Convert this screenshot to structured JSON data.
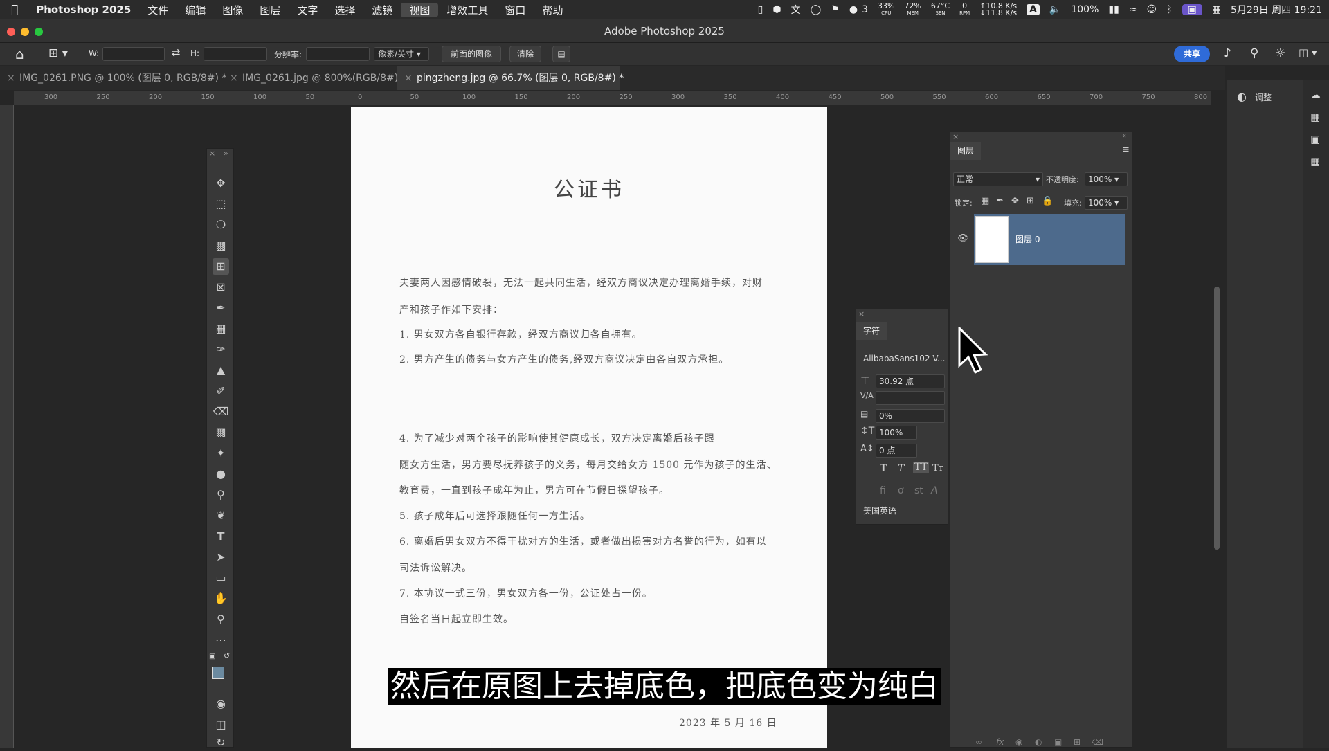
{
  "menubar": {
    "app_name": "Photoshop 2025",
    "items": [
      "文件",
      "编辑",
      "图像",
      "图层",
      "文字",
      "选择",
      "滤镜",
      "视图",
      "增效工具",
      "窗口",
      "帮助"
    ],
    "active_item": "视图",
    "wechat_count": "3",
    "cpu": "33%",
    "cpu_label": "CPU",
    "mem": "72%",
    "mem_label": "MEM",
    "temp": "67°C",
    "temp_label": "SEN",
    "rpm": "0",
    "rpm_label": "RPM",
    "net_up": "↑10.8 K/s",
    "net_down": "↓11.8 K/s",
    "input_method": "A",
    "battery": "100%",
    "datetime": "5月29日 周四  19:21"
  },
  "window": {
    "title": "Adobe Photoshop 2025"
  },
  "options": {
    "w_label": "W:",
    "h_label": "H:",
    "resolution_label": "分辨率:",
    "unit_select": "像素/英寸",
    "front_image_button": "前面的图像",
    "clear_button": "清除",
    "share_button": "共享"
  },
  "tabs": [
    {
      "label": "IMG_0261.PNG @ 100% (图层 0, RGB/8#) *"
    },
    {
      "label": "IMG_0261.jpg @ 800%(RGB/8#)"
    },
    {
      "label": "pingzheng.jpg @ 66.7% (图层 0, RGB/8#) *"
    }
  ],
  "ruler_ticks": [
    "300",
    "250",
    "200",
    "150",
    "100",
    "50",
    "0",
    "50",
    "100",
    "150",
    "200",
    "250",
    "300",
    "350",
    "400",
    "450",
    "500",
    "550",
    "600",
    "650",
    "700",
    "750",
    "800"
  ],
  "document": {
    "title": "公证书",
    "paragraphs": [
      "夫妻两人因感情破裂，无法一起共同生活，经双方商议决定办理离婚手续，对财",
      "产和孩子作如下安排：",
      "1. 男女双方各自银行存款，经双方商议归各自拥有。",
      "2. 男方产生的债务与女方产生的债务,经双方商议决定由各自双方承担。",
      "4. 为了减少对两个孩子的影响使其健康成长，双方决定离婚后孩子跟",
      "随女方生活，男方要尽抚养孩子的义务，每月交给女方 1500 元作为孩子的生活、",
      "教育费，一直到孩子成年为止，男方可在节假日探望孩子。",
      "5. 孩子成年后可选择跟随任何一方生活。",
      "6. 离婚后男女双方不得干扰对方的生活，或者做出损害对方名誉的行为，如有以",
      "司法诉讼解决。",
      "7. 本协议一式三份，男女双方各一份，公证处占一份。",
      "自签名当日起立即生效。"
    ],
    "date": "2023 年 5 月 16 日"
  },
  "layers_panel": {
    "tab": "图层",
    "blend_mode": "正常",
    "opacity_label": "不透明度:",
    "opacity": "100%",
    "lock_label": "锁定:",
    "fill_label": "填充:",
    "fill": "100%",
    "layers": [
      {
        "name": "图层 0"
      }
    ]
  },
  "character_panel": {
    "tab": "字符",
    "font": "AlibabaSans102 V...",
    "size": "30.92 点",
    "tracking": "0%",
    "vscale": "100%",
    "baseline": "0 点",
    "language": "美国英语"
  },
  "right_panel": {
    "adjust_label": "调整"
  },
  "subtitle": "然后在原图上去掉底色，把底色变为纯白",
  "colors": {
    "accent": "#2f6bd8",
    "layer_selected": "#4d6a8c",
    "menu_highlight": "#6a55c9"
  }
}
